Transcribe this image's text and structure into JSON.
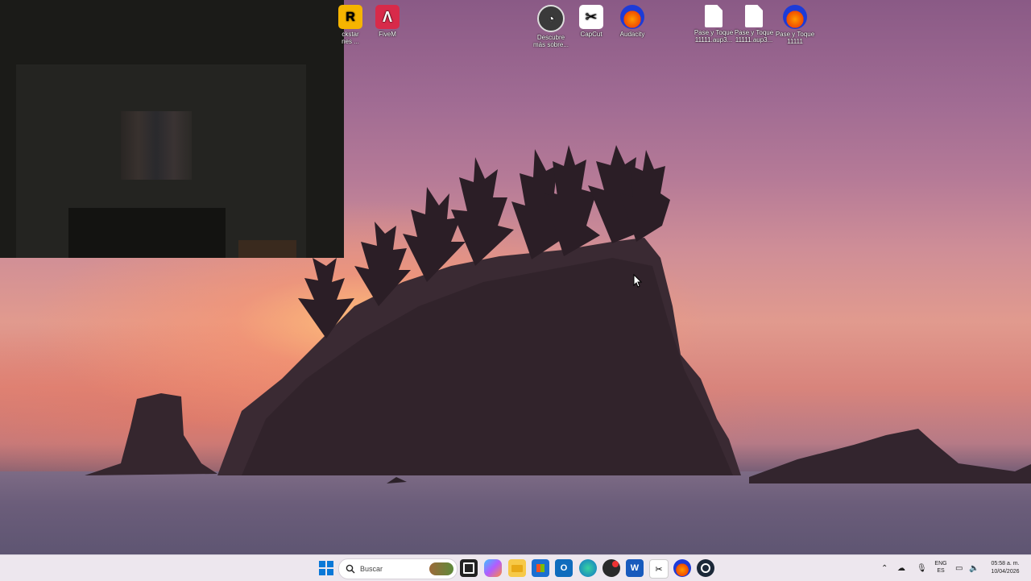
{
  "desktop": {
    "icons": [
      {
        "name": "rockstar-icon",
        "glyph": "R",
        "label": "ckstar\nnes ..."
      },
      {
        "name": "fivem-icon",
        "glyph": "Λ",
        "label": "FiveM"
      },
      {
        "name": "descubre-icon",
        "glyph": "◔",
        "label": "Descubre\nmás sobre..."
      },
      {
        "name": "capcut-icon",
        "glyph": "✂",
        "label": "CapCut"
      },
      {
        "name": "audacity-icon",
        "glyph": "",
        "label": "Audacity"
      },
      {
        "name": "file-pase-1-icon",
        "glyph": "",
        "label": "Pase y Toque\n11111.aup3..."
      },
      {
        "name": "file-pase-2-icon",
        "glyph": "",
        "label": "Pase y Toque\n11111.aup3..."
      },
      {
        "name": "audacity-project-icon",
        "glyph": "",
        "label": "Pase y Toque\n11111"
      }
    ]
  },
  "taskbar": {
    "search_placeholder": "Buscar",
    "apps": [
      "start-icon",
      "task-view-icon",
      "copilot-icon",
      "file-explorer-icon",
      "store-icon",
      "outlook-icon",
      "edge-icon",
      "obs-icon",
      "word-icon",
      "capcut-icon",
      "audacity-icon",
      "steam-icon"
    ],
    "tray": {
      "lang_line1": "ENG",
      "lang_line2": "ES",
      "time": "05:58 a. m.",
      "date": "10/04/2026"
    }
  },
  "colors": {
    "taskbar_bg": "#ede7ee",
    "accent": "#0067c0"
  }
}
